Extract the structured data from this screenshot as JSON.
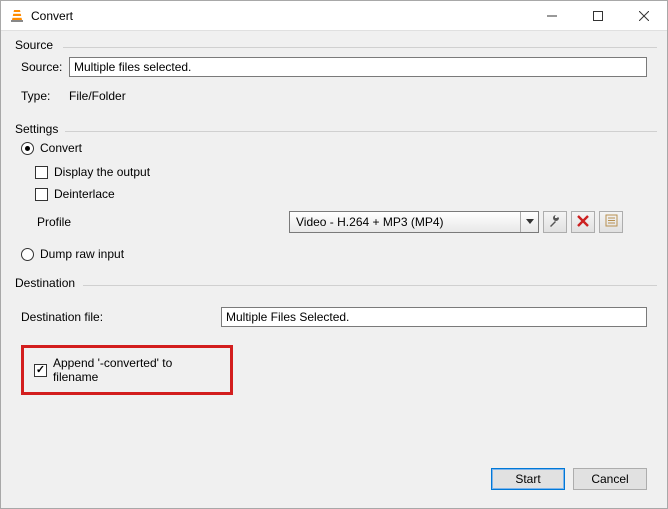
{
  "window": {
    "title": "Convert"
  },
  "source": {
    "group_label": "Source",
    "source_label": "Source:",
    "source_value": "Multiple files selected.",
    "type_label": "Type:",
    "type_value": "File/Folder"
  },
  "settings": {
    "group_label": "Settings",
    "convert_label": "Convert",
    "display_output_label": "Display the output",
    "deinterlace_label": "Deinterlace",
    "profile_label": "Profile",
    "profile_value": "Video - H.264 + MP3 (MP4)",
    "dump_raw_label": "Dump raw input",
    "icons": {
      "wrench": "wrench-icon",
      "delete": "delete-icon",
      "new": "new-profile-icon"
    }
  },
  "destination": {
    "group_label": "Destination",
    "file_label": "Destination file:",
    "file_value": "Multiple Files Selected.",
    "append_label": "Append '-converted' to filename"
  },
  "buttons": {
    "start": "Start",
    "cancel": "Cancel"
  }
}
